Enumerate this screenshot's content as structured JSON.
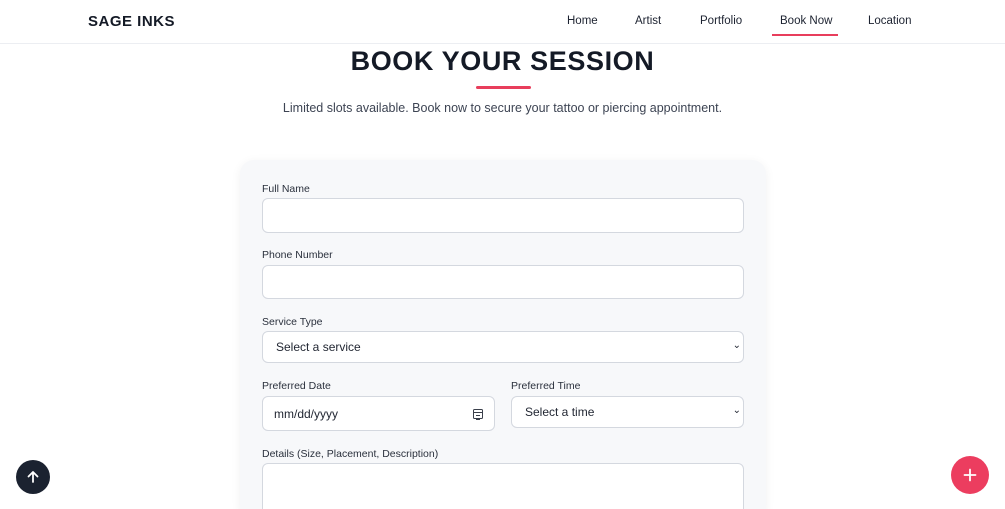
{
  "nav": {
    "brand": "SAGE INKS",
    "items": [
      {
        "label": "Home"
      },
      {
        "label": "Artist"
      },
      {
        "label": "Portfolio"
      },
      {
        "label": "Book Now",
        "active": true
      },
      {
        "label": "Location"
      }
    ]
  },
  "hero": {
    "title": "BOOK YOUR SESSION",
    "subtitle": "Limited slots available. Book now to secure your tattoo or piercing appointment."
  },
  "form": {
    "full_name": {
      "label": "Full Name",
      "value": ""
    },
    "phone": {
      "label": "Phone Number",
      "value": ""
    },
    "service": {
      "label": "Service Type",
      "selected": "Select a service"
    },
    "date": {
      "label": "Preferred Date",
      "placeholder": "mm/dd/yyyy"
    },
    "time": {
      "label": "Preferred Time",
      "selected": "Select a time"
    },
    "details": {
      "label": "Details (Size, Placement, Description)",
      "value": ""
    }
  },
  "icons": {
    "scroll_top": "arrow-up-icon",
    "fab": "plus-icon",
    "date_picker": "calendar-icon",
    "dropdown": "chevron-down-icon"
  },
  "colors": {
    "accent": "#e83e5c",
    "dark": "#1b2230",
    "card_bg": "#f7f8fa"
  }
}
